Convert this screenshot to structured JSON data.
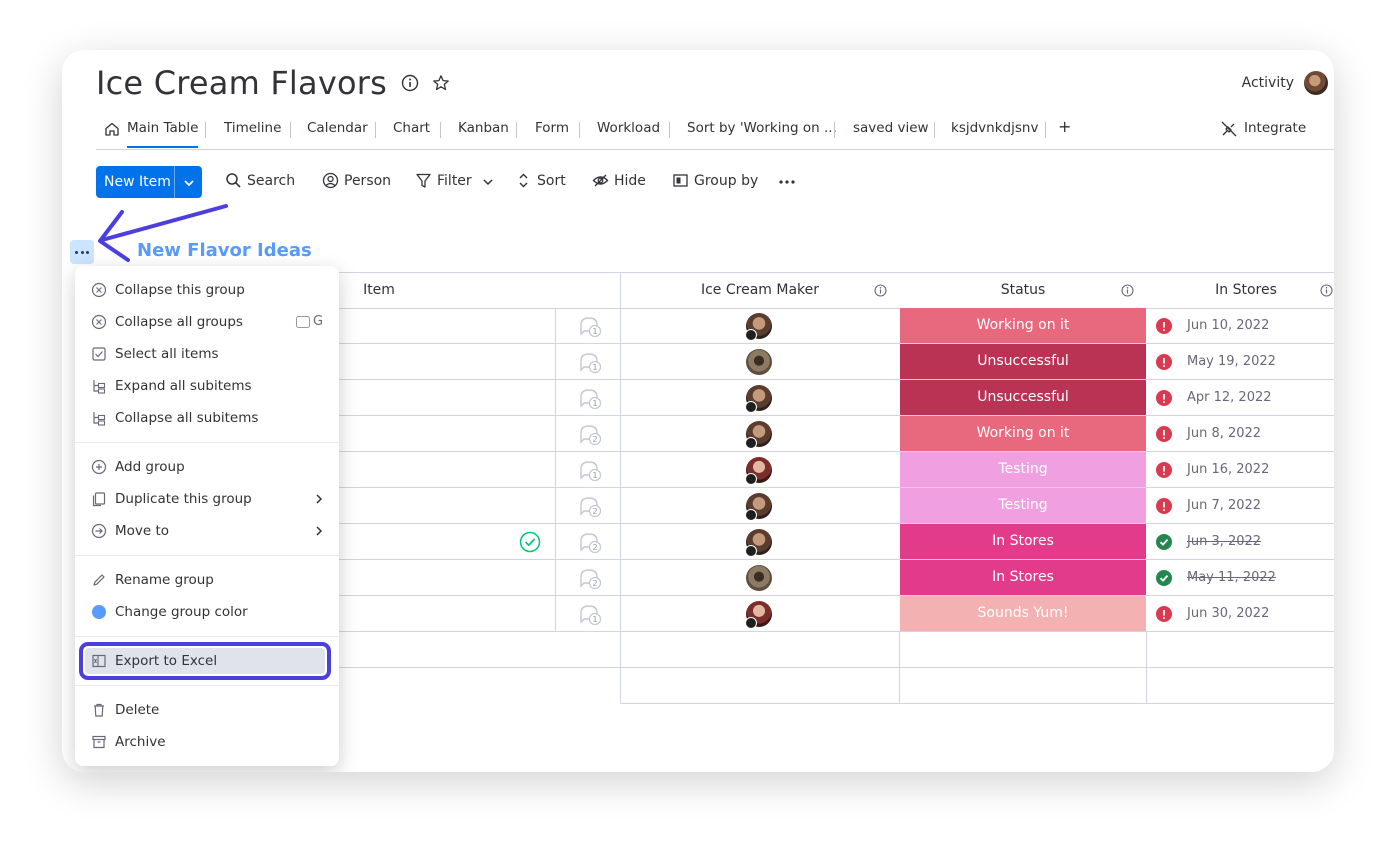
{
  "board": {
    "title": "Ice Cream Flavors",
    "activity_label": "Activity"
  },
  "tabs": [
    {
      "label": "Main Table"
    },
    {
      "label": "Timeline"
    },
    {
      "label": "Calendar"
    },
    {
      "label": "Chart"
    },
    {
      "label": "Kanban"
    },
    {
      "label": "Form"
    },
    {
      "label": "Workload"
    },
    {
      "label": "Sort by 'Working on ..."
    },
    {
      "label": "saved view"
    },
    {
      "label": "ksjdvnkdjsnv"
    },
    {
      "label": "+"
    }
  ],
  "integrate_label": "Integrate",
  "toolbar": {
    "new_item": "New Item",
    "search": "Search",
    "person": "Person",
    "filter": "Filter",
    "sort": "Sort",
    "hide": "Hide",
    "group_by": "Group by"
  },
  "group": {
    "title": "New Flavor Ideas",
    "color": "#579bfc"
  },
  "columns": {
    "item": "Item",
    "maker": "Ice Cream Maker",
    "status": "Status",
    "in_stores": "In Stores"
  },
  "rows": [
    {
      "updates": "1",
      "status": "Working on it",
      "status_color": "#e8697d",
      "date": "Jun 10, 2022",
      "done": false
    },
    {
      "updates": "1",
      "status": "Unsuccessful",
      "status_color": "#bb3354",
      "date": "May 19, 2022",
      "done": false
    },
    {
      "updates": "1",
      "status": "Unsuccessful",
      "status_color": "#bb3354",
      "date": "Apr 12, 2022",
      "done": false
    },
    {
      "updates": "2",
      "status": "Working on it",
      "status_color": "#e8697d",
      "date": "Jun 8, 2022",
      "done": false
    },
    {
      "updates": "1",
      "status": "Testing",
      "status_color": "#f0a0e0",
      "date": "Jun 16, 2022",
      "done": false
    },
    {
      "updates": "2",
      "status": "Testing",
      "status_color": "#f0a0e0",
      "date": "Jun 7, 2022",
      "done": false
    },
    {
      "updates": "2",
      "status": "In Stores",
      "status_color": "#e33b8c",
      "date": "Jun 3, 2022",
      "done": true
    },
    {
      "updates": "2",
      "status": "In Stores",
      "status_color": "#e33b8c",
      "date": "May 11, 2022",
      "done": true
    },
    {
      "updates": "1",
      "status": "Sounds Yum!",
      "status_color": "#f4b1b1",
      "date": "Jun 30, 2022",
      "done": false
    }
  ],
  "menu": {
    "collapse_group": "Collapse this group",
    "collapse_all": "Collapse all groups",
    "collapse_all_shortcut": "G",
    "select_all": "Select all items",
    "expand_sub": "Expand all subitems",
    "collapse_sub": "Collapse all subitems",
    "add_group": "Add group",
    "duplicate": "Duplicate this group",
    "move_to": "Move to",
    "rename": "Rename group",
    "change_color": "Change group color",
    "export": "Export to Excel",
    "delete": "Delete",
    "archive": "Archive"
  }
}
